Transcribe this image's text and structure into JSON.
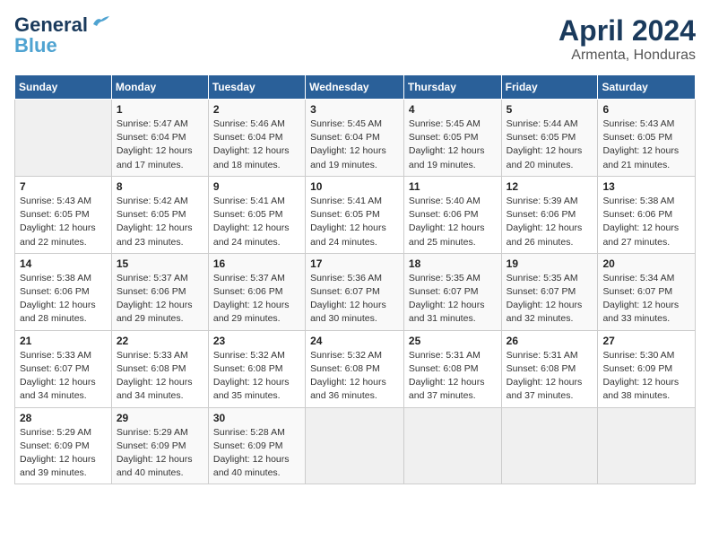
{
  "logo": {
    "line1": "General",
    "line2": "Blue"
  },
  "title": "April 2024",
  "subtitle": "Armenta, Honduras",
  "days_of_week": [
    "Sunday",
    "Monday",
    "Tuesday",
    "Wednesday",
    "Thursday",
    "Friday",
    "Saturday"
  ],
  "weeks": [
    [
      {
        "day": "",
        "info": ""
      },
      {
        "day": "1",
        "info": "Sunrise: 5:47 AM\nSunset: 6:04 PM\nDaylight: 12 hours\nand 17 minutes."
      },
      {
        "day": "2",
        "info": "Sunrise: 5:46 AM\nSunset: 6:04 PM\nDaylight: 12 hours\nand 18 minutes."
      },
      {
        "day": "3",
        "info": "Sunrise: 5:45 AM\nSunset: 6:04 PM\nDaylight: 12 hours\nand 19 minutes."
      },
      {
        "day": "4",
        "info": "Sunrise: 5:45 AM\nSunset: 6:05 PM\nDaylight: 12 hours\nand 19 minutes."
      },
      {
        "day": "5",
        "info": "Sunrise: 5:44 AM\nSunset: 6:05 PM\nDaylight: 12 hours\nand 20 minutes."
      },
      {
        "day": "6",
        "info": "Sunrise: 5:43 AM\nSunset: 6:05 PM\nDaylight: 12 hours\nand 21 minutes."
      }
    ],
    [
      {
        "day": "7",
        "info": "Sunrise: 5:43 AM\nSunset: 6:05 PM\nDaylight: 12 hours\nand 22 minutes."
      },
      {
        "day": "8",
        "info": "Sunrise: 5:42 AM\nSunset: 6:05 PM\nDaylight: 12 hours\nand 23 minutes."
      },
      {
        "day": "9",
        "info": "Sunrise: 5:41 AM\nSunset: 6:05 PM\nDaylight: 12 hours\nand 24 minutes."
      },
      {
        "day": "10",
        "info": "Sunrise: 5:41 AM\nSunset: 6:05 PM\nDaylight: 12 hours\nand 24 minutes."
      },
      {
        "day": "11",
        "info": "Sunrise: 5:40 AM\nSunset: 6:06 PM\nDaylight: 12 hours\nand 25 minutes."
      },
      {
        "day": "12",
        "info": "Sunrise: 5:39 AM\nSunset: 6:06 PM\nDaylight: 12 hours\nand 26 minutes."
      },
      {
        "day": "13",
        "info": "Sunrise: 5:38 AM\nSunset: 6:06 PM\nDaylight: 12 hours\nand 27 minutes."
      }
    ],
    [
      {
        "day": "14",
        "info": "Sunrise: 5:38 AM\nSunset: 6:06 PM\nDaylight: 12 hours\nand 28 minutes."
      },
      {
        "day": "15",
        "info": "Sunrise: 5:37 AM\nSunset: 6:06 PM\nDaylight: 12 hours\nand 29 minutes."
      },
      {
        "day": "16",
        "info": "Sunrise: 5:37 AM\nSunset: 6:06 PM\nDaylight: 12 hours\nand 29 minutes."
      },
      {
        "day": "17",
        "info": "Sunrise: 5:36 AM\nSunset: 6:07 PM\nDaylight: 12 hours\nand 30 minutes."
      },
      {
        "day": "18",
        "info": "Sunrise: 5:35 AM\nSunset: 6:07 PM\nDaylight: 12 hours\nand 31 minutes."
      },
      {
        "day": "19",
        "info": "Sunrise: 5:35 AM\nSunset: 6:07 PM\nDaylight: 12 hours\nand 32 minutes."
      },
      {
        "day": "20",
        "info": "Sunrise: 5:34 AM\nSunset: 6:07 PM\nDaylight: 12 hours\nand 33 minutes."
      }
    ],
    [
      {
        "day": "21",
        "info": "Sunrise: 5:33 AM\nSunset: 6:07 PM\nDaylight: 12 hours\nand 34 minutes."
      },
      {
        "day": "22",
        "info": "Sunrise: 5:33 AM\nSunset: 6:08 PM\nDaylight: 12 hours\nand 34 minutes."
      },
      {
        "day": "23",
        "info": "Sunrise: 5:32 AM\nSunset: 6:08 PM\nDaylight: 12 hours\nand 35 minutes."
      },
      {
        "day": "24",
        "info": "Sunrise: 5:32 AM\nSunset: 6:08 PM\nDaylight: 12 hours\nand 36 minutes."
      },
      {
        "day": "25",
        "info": "Sunrise: 5:31 AM\nSunset: 6:08 PM\nDaylight: 12 hours\nand 37 minutes."
      },
      {
        "day": "26",
        "info": "Sunrise: 5:31 AM\nSunset: 6:08 PM\nDaylight: 12 hours\nand 37 minutes."
      },
      {
        "day": "27",
        "info": "Sunrise: 5:30 AM\nSunset: 6:09 PM\nDaylight: 12 hours\nand 38 minutes."
      }
    ],
    [
      {
        "day": "28",
        "info": "Sunrise: 5:29 AM\nSunset: 6:09 PM\nDaylight: 12 hours\nand 39 minutes."
      },
      {
        "day": "29",
        "info": "Sunrise: 5:29 AM\nSunset: 6:09 PM\nDaylight: 12 hours\nand 40 minutes."
      },
      {
        "day": "30",
        "info": "Sunrise: 5:28 AM\nSunset: 6:09 PM\nDaylight: 12 hours\nand 40 minutes."
      },
      {
        "day": "",
        "info": ""
      },
      {
        "day": "",
        "info": ""
      },
      {
        "day": "",
        "info": ""
      },
      {
        "day": "",
        "info": ""
      }
    ]
  ]
}
